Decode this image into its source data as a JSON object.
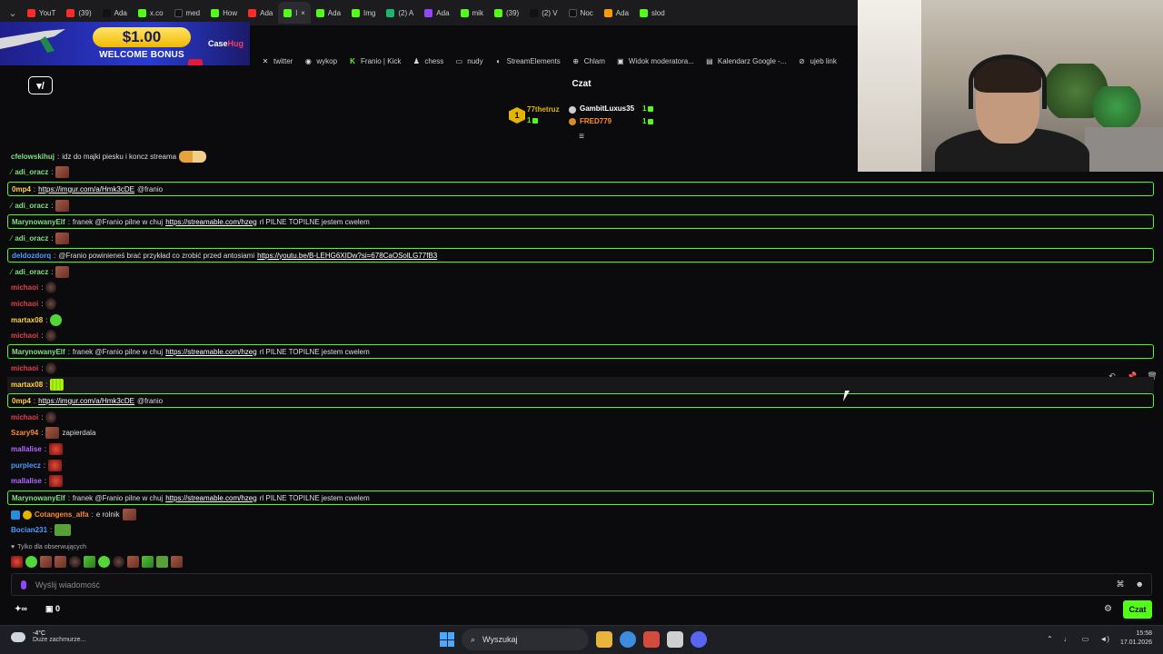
{
  "browser": {
    "tabs": [
      "YouT",
      "(39)",
      "Ada",
      "x.co",
      "med",
      "How",
      "Ada",
      "l",
      "Ada",
      "Img",
      "(2) A",
      "Ada",
      "mik",
      "(39)",
      "(2) V",
      "Noc",
      "Ada",
      "slod"
    ],
    "active_tab_index": 7
  },
  "promo": {
    "amount": "$1.00",
    "subtitle": "WELCOME BONUS",
    "brand_a": "Case",
    "brand_b": "Hug"
  },
  "bookmarks": [
    "twitter",
    "wykop",
    "Franio | Kick",
    "chess",
    "nudy",
    "StreamElements",
    "Chlam",
    "Widok moderatora...",
    "Kalendarz Google -...",
    "ujeb link"
  ],
  "header": {
    "chat_title": "Czat"
  },
  "leaderboard": {
    "rank": "1",
    "first": {
      "name": "77thetruz",
      "value": "1"
    },
    "second": {
      "name": "GambitLuxus35",
      "value": "1"
    },
    "third": {
      "name": "FRED779",
      "value": "1"
    },
    "first_sub_value": "1"
  },
  "chat": {
    "messages": [
      {
        "user": "cfelowskihuj",
        "color": "#7ee07e",
        "text": "idz do majki piesku i koncz streama",
        "emote": "duo",
        "highlight": false
      },
      {
        "user": "adi_oracz",
        "color": "#7ee07e",
        "text": "",
        "emote": "face",
        "highlight": false,
        "badge": true
      },
      {
        "user": "0mp4",
        "color": "#ffd43b",
        "link": "https://imgur.com/a/Hmk3cDE",
        "after": "@franio",
        "highlight": true
      },
      {
        "user": "adi_oracz",
        "color": "#7ee07e",
        "text": "",
        "emote": "face",
        "highlight": false,
        "badge": true
      },
      {
        "user": "MarynowanyElf",
        "color": "#7ee07e",
        "text": "franek @Franio pilne w chuj",
        "link": "https://streamable.com/hzeg",
        "after": "rl PILNE TOPILNE jestem cwelem",
        "highlight": true
      },
      {
        "user": "adi_oracz",
        "color": "#7ee07e",
        "text": "",
        "emote": "face",
        "highlight": false,
        "badge": true
      },
      {
        "user": "deldozdorq",
        "color": "#4a9cff",
        "text": "@Franio powinieneś brać przykład co zrobić przed antosiami",
        "link": "https://youtu.be/B-LEHG6XIDw?si=678CaOSolLG77fB3",
        "highlight": true
      },
      {
        "user": "adi_oracz",
        "color": "#7ee07e",
        "text": "",
        "emote": "face",
        "highlight": false,
        "badge": true
      },
      {
        "user": "michaoi",
        "color": "#e0414a",
        "text": "",
        "emote": "dark",
        "highlight": false
      },
      {
        "user": "michaoi",
        "color": "#e0414a",
        "text": "",
        "emote": "dark",
        "highlight": false
      },
      {
        "user": "martax08",
        "color": "#ffd43b",
        "text": "",
        "emote": "green",
        "highlight": false
      },
      {
        "user": "michaoi",
        "color": "#e0414a",
        "text": "",
        "emote": "dark",
        "highlight": false
      },
      {
        "user": "MarynowanyElf",
        "color": "#7ee07e",
        "text": "franek @Franio pilne w chuj",
        "link": "https://streamable.com/hzeg",
        "after": "rl PILNE TOPILNE jestem cwelem",
        "highlight": true
      },
      {
        "user": "michaoi",
        "color": "#e0414a",
        "text": "",
        "emote": "dark",
        "highlight": false
      },
      {
        "user": "martax08",
        "color": "#ffd43b",
        "text": "",
        "emote": "bars",
        "highlight": false,
        "hover": true
      },
      {
        "user": "0mp4",
        "color": "#ffd43b",
        "link": "https://imgur.com/a/Hmk3cDE",
        "after": "@franio",
        "highlight": true
      },
      {
        "user": "michaoi",
        "color": "#e0414a",
        "text": "",
        "emote": "dark",
        "highlight": false
      },
      {
        "user": "Szary94",
        "color": "#ff8c2a",
        "text": "zapierdala",
        "emote": "face",
        "highlight": false
      },
      {
        "user": "mallalise",
        "color": "#b467ff",
        "text": "",
        "emote": "red",
        "highlight": false
      },
      {
        "user": "purplecz",
        "color": "#4a9cff",
        "text": "",
        "emote": "red",
        "highlight": false
      },
      {
        "user": "mallalise",
        "color": "#b467ff",
        "text": "",
        "emote": "red",
        "highlight": false
      },
      {
        "user": "MarynowanyElf",
        "color": "#7ee07e",
        "text": "franek @Franio pilne w chuj",
        "link": "https://streamable.com/hzeg",
        "after": "rl PILNE TOPILNE jestem cwelem",
        "highlight": true
      },
      {
        "user": "Cotangens_alfa",
        "color": "#ff8c2a",
        "text": "e rolnik",
        "emote": "face",
        "highlight": false,
        "subbadge": true
      },
      {
        "user": "Bocian231",
        "color": "#4a9cff",
        "text": "",
        "emote": "pepe",
        "highlight": false
      }
    ],
    "followers_only": "Tylko dla obserwujących",
    "input_placeholder": "Wyślij wiadomość",
    "send_label": "Czat",
    "points_value": "0"
  },
  "taskbar": {
    "temp": "-4°C",
    "weather": "Duże zachmurze...",
    "search": "Wyszukaj",
    "time": "15:58",
    "date": "17.01.2026"
  },
  "colors": {
    "kick_green": "#53fc18",
    "gold": "#e3b400"
  }
}
